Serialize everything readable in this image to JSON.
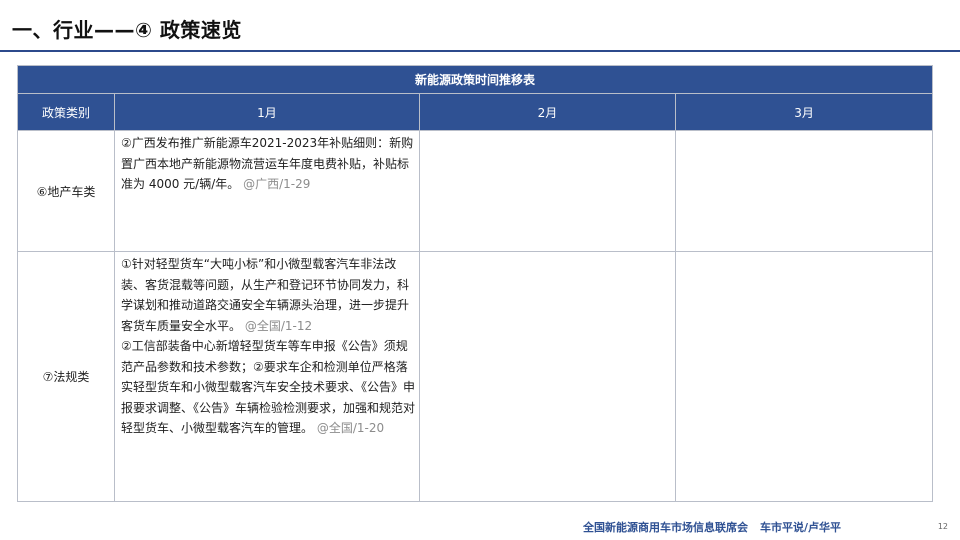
{
  "header": {
    "title": "一、行业——④ 政策速览"
  },
  "table": {
    "caption": "新能源政策时间推移表",
    "columns": [
      "政策类别",
      "1月",
      "2月",
      "3月"
    ],
    "rows": [
      {
        "category": "⑥地产车类",
        "jan": [
          {
            "text": "②广西发布推广新能源车2021-2023年补贴细则：新购置广西本地产新能源物流营运车年度电费补贴，补贴标准为 4000 元/辆/年。",
            "source": "@广西/1-29"
          }
        ],
        "feb": "",
        "mar": ""
      },
      {
        "category": "⑦法规类",
        "jan": [
          {
            "text": "①针对轻型货车“大吨小标”和小微型载客汽车非法改装、客货混载等问题，从生产和登记环节协同发力，科学谋划和推动道路交通安全车辆源头治理，进一步提升客货车质量安全水平。",
            "source": "@全国/1-12"
          },
          {
            "text": "②工信部装备中心新增轻型货车等车申报《公告》须规范产品参数和技术参数；②要求车企和检测单位严格落实轻型货车和小微型载客汽车安全技术要求、《公告》申报要求调整、《公告》车辆检验检测要求，加强和规范对轻型货车、小微型载客汽车的管理。",
            "source": "@全国/1-20"
          }
        ],
        "feb": "",
        "mar": ""
      }
    ]
  },
  "footer": {
    "org": "全国新能源商用车市场信息联席会",
    "author": "车市平说/卢华平",
    "page": "12"
  },
  "colors": {
    "accent": "#2f5193",
    "source_text": "#8c8c8c"
  }
}
